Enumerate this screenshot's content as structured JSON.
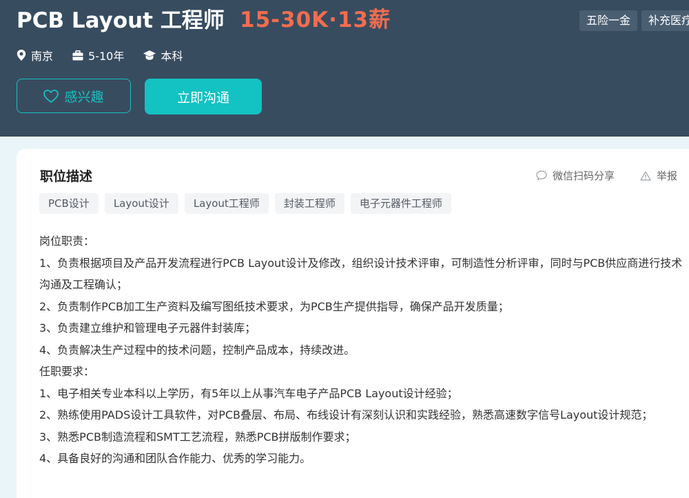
{
  "job": {
    "title": "PCB Layout 工程师",
    "salary": "15-30K·13薪",
    "benefits": [
      "五险一金",
      "补充医疗"
    ],
    "location": "南京",
    "experience": "5-10年",
    "education": "本科"
  },
  "actions": {
    "interest_label": "感兴趣",
    "chat_label": "立即沟通"
  },
  "description": {
    "title": "职位描述",
    "share_label": "微信扫码分享",
    "report_label": "举报",
    "tags": [
      "PCB设计",
      "Layout设计",
      "Layout工程师",
      "封装工程师",
      "电子元器件工程师"
    ],
    "lines": [
      "岗位职责：",
      "1、负责根据项目及产品开发流程进行PCB Layout设计及修改，组织设计技术评审，可制造性分析评审，同时与PCB供应商进行技术沟通及工程确认；",
      "2、负责制作PCB加工生产资料及编写图纸技术要求，为PCB生产提供指导，确保产品开发质量；",
      "3、负责建立维护和管理电子元器件封装库；",
      "4、负责解决生产过程中的技术问题，控制产品成本，持续改进。",
      "任职要求：",
      "1、电子相关专业本科以上学历，有5年以上从事汽车电子产品PCB Layout设计经验；",
      "2、熟练使用PADS设计工具软件，对PCB叠层、布局、布线设计有深刻认识和实践经验，熟悉高速数字信号Layout设计规范；",
      "3、熟悉PCB制造流程和SMT工艺流程，熟悉PCB拼版制作要求；",
      "4、具备良好的沟通和团队合作能力、优秀的学习能力。"
    ]
  },
  "colors": {
    "header_bg": "#384c60",
    "salary": "#f26d4f",
    "accent": "#13c2c2",
    "page_bg": "#eaf5f9"
  },
  "icons": [
    "location-pin-icon",
    "briefcase-icon",
    "graduation-cap-icon",
    "heart-icon",
    "chat-bubble-icon",
    "warning-icon"
  ]
}
